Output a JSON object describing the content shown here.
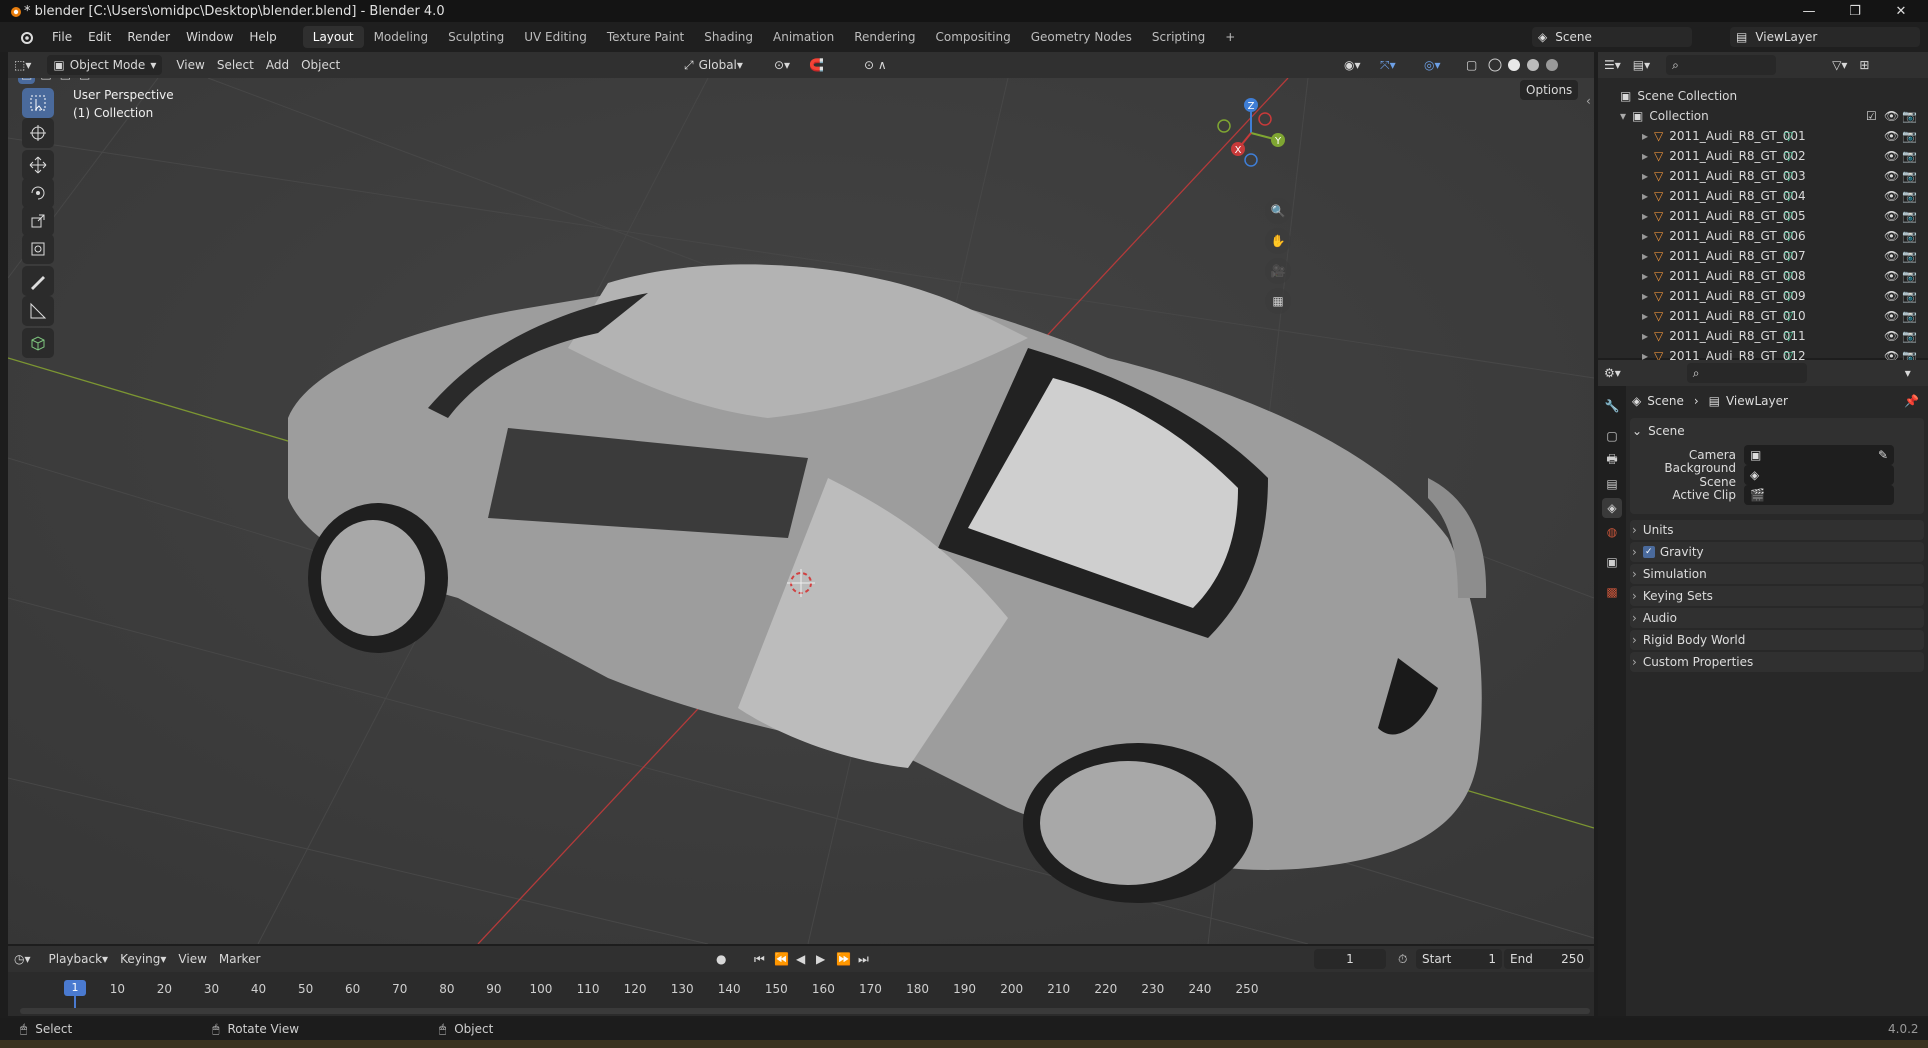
{
  "window": {
    "title": "* blender [C:\\Users\\omidpc\\Desktop\\blender.blend] - Blender 4.0"
  },
  "menubar": {
    "menus": [
      "File",
      "Edit",
      "Render",
      "Window",
      "Help"
    ],
    "workspaces": [
      "Layout",
      "Modeling",
      "Sculpting",
      "UV Editing",
      "Texture Paint",
      "Shading",
      "Animation",
      "Rendering",
      "Compositing",
      "Geometry Nodes",
      "Scripting"
    ],
    "active_workspace": "Layout",
    "scene": "Scene",
    "view_layer": "ViewLayer"
  },
  "viewport_header": {
    "mode": "Object Mode",
    "menus": [
      "View",
      "Select",
      "Add",
      "Object"
    ],
    "orientation": "Global",
    "options": "Options"
  },
  "viewport": {
    "perspective": "User Perspective",
    "collection": "(1) Collection",
    "gizmo": {
      "x": "X",
      "y": "Y",
      "z": "Z"
    }
  },
  "outliner": {
    "root": "Scene Collection",
    "collection": "Collection",
    "objects": [
      "2011_Audi_R8_GT_001",
      "2011_Audi_R8_GT_002",
      "2011_Audi_R8_GT_003",
      "2011_Audi_R8_GT_004",
      "2011_Audi_R8_GT_005",
      "2011_Audi_R8_GT_006",
      "2011_Audi_R8_GT_007",
      "2011_Audi_R8_GT_008",
      "2011_Audi_R8_GT_009",
      "2011_Audi_R8_GT_010",
      "2011_Audi_R8_GT_011",
      "2011_Audi_R8_GT_012"
    ]
  },
  "properties": {
    "breadcrumb": {
      "scene": "Scene",
      "view_layer": "ViewLayer"
    },
    "scene_panel": "Scene",
    "fields": {
      "camera": "Camera",
      "background_scene": "Background Scene",
      "active_clip": "Active Clip"
    },
    "panels": [
      "Units",
      "Gravity",
      "Simulation",
      "Keying Sets",
      "Audio",
      "Rigid Body World",
      "Custom Properties"
    ],
    "gravity_checked": true
  },
  "timeline": {
    "menus": [
      "Playback",
      "Keying",
      "View",
      "Marker"
    ],
    "current_frame": "1",
    "start_label": "Start",
    "start": "1",
    "end_label": "End",
    "end": "250",
    "ticks": [
      "10",
      "20",
      "30",
      "40",
      "50",
      "60",
      "70",
      "80",
      "90",
      "100",
      "110",
      "120",
      "130",
      "140",
      "150",
      "160",
      "170",
      "180",
      "190",
      "200",
      "210",
      "220",
      "230",
      "240",
      "250"
    ],
    "playhead": "1"
  },
  "statusbar": {
    "select": "Select",
    "rotate": "Rotate View",
    "object": "Object",
    "version": "4.0.2"
  },
  "colors": {
    "accent": "#4a6a9c",
    "x_axis": "#c83a3a",
    "y_axis": "#7fa632",
    "z_axis": "#3f7ed6"
  }
}
